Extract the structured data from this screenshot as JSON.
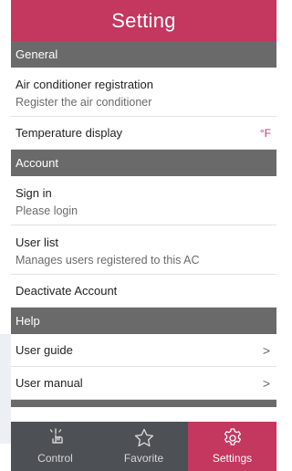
{
  "header": {
    "title": "Setting"
  },
  "sections": {
    "general": {
      "label": "General",
      "ac_registration": {
        "title": "Air conditioner registration",
        "subtitle": "Register the air conditioner"
      },
      "temperature_display": {
        "title": "Temperature display",
        "value": "°F"
      }
    },
    "account": {
      "label": "Account",
      "sign_in": {
        "title": "Sign in",
        "subtitle": "Please login"
      },
      "user_list": {
        "title": "User list",
        "subtitle": "Manages users registered to this AC"
      },
      "deactivate": {
        "title": "Deactivate Account"
      }
    },
    "help": {
      "label": "Help",
      "user_guide": {
        "title": "User guide",
        "chevron": ">"
      },
      "user_manual": {
        "title": "User manual",
        "chevron": ">"
      }
    }
  },
  "tabbar": {
    "control": {
      "label": "Control",
      "icon": "hand-pointer-icon"
    },
    "favorite": {
      "label": "Favorite",
      "icon": "star-icon"
    },
    "settings": {
      "label": "Settings",
      "icon": "gear-icon",
      "active": true
    }
  },
  "colors": {
    "accent": "#c4375f",
    "section_bg": "#6a6a6a",
    "tabbar_bg": "#4d5055"
  }
}
